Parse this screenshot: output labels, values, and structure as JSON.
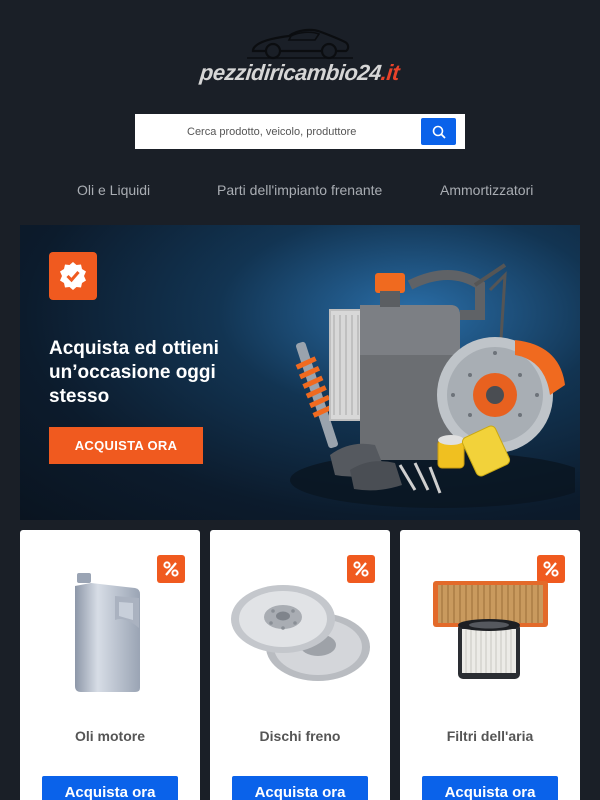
{
  "header": {
    "logo_text": "pezzidiricambio24",
    "logo_tld": ".it",
    "logo_icon": "sports-car-icon"
  },
  "search": {
    "placeholder": "Cerca prodotto, veicolo, produttore",
    "button_icon": "search-icon"
  },
  "nav": {
    "items": [
      {
        "label": "Oli e Liquidi"
      },
      {
        "label": "Parti dell'impianto frenante"
      },
      {
        "label": "Ammortizzatori"
      }
    ]
  },
  "banner": {
    "badge_icon": "verified-badge-icon",
    "headline": "Acquista ed ottieni un’occasione oggi stesso",
    "cta_label": "ACQUISTA ORA"
  },
  "products": [
    {
      "title": "Oli motore",
      "button_label": "Acquista ora",
      "badge_icon": "percent-icon",
      "image_icon": "oil-can-icon"
    },
    {
      "title": "Dischi freno",
      "button_label": "Acquista ora",
      "badge_icon": "percent-icon",
      "image_icon": "brake-disc-icon"
    },
    {
      "title": "Filtri dell'aria",
      "button_label": "Acquista ora",
      "badge_icon": "percent-icon",
      "image_icon": "air-filter-icon"
    }
  ],
  "colors": {
    "background": "#1a1f27",
    "accent_orange": "#f05a1f",
    "accent_blue": "#0a62ea",
    "logo_red": "#e8422a"
  }
}
